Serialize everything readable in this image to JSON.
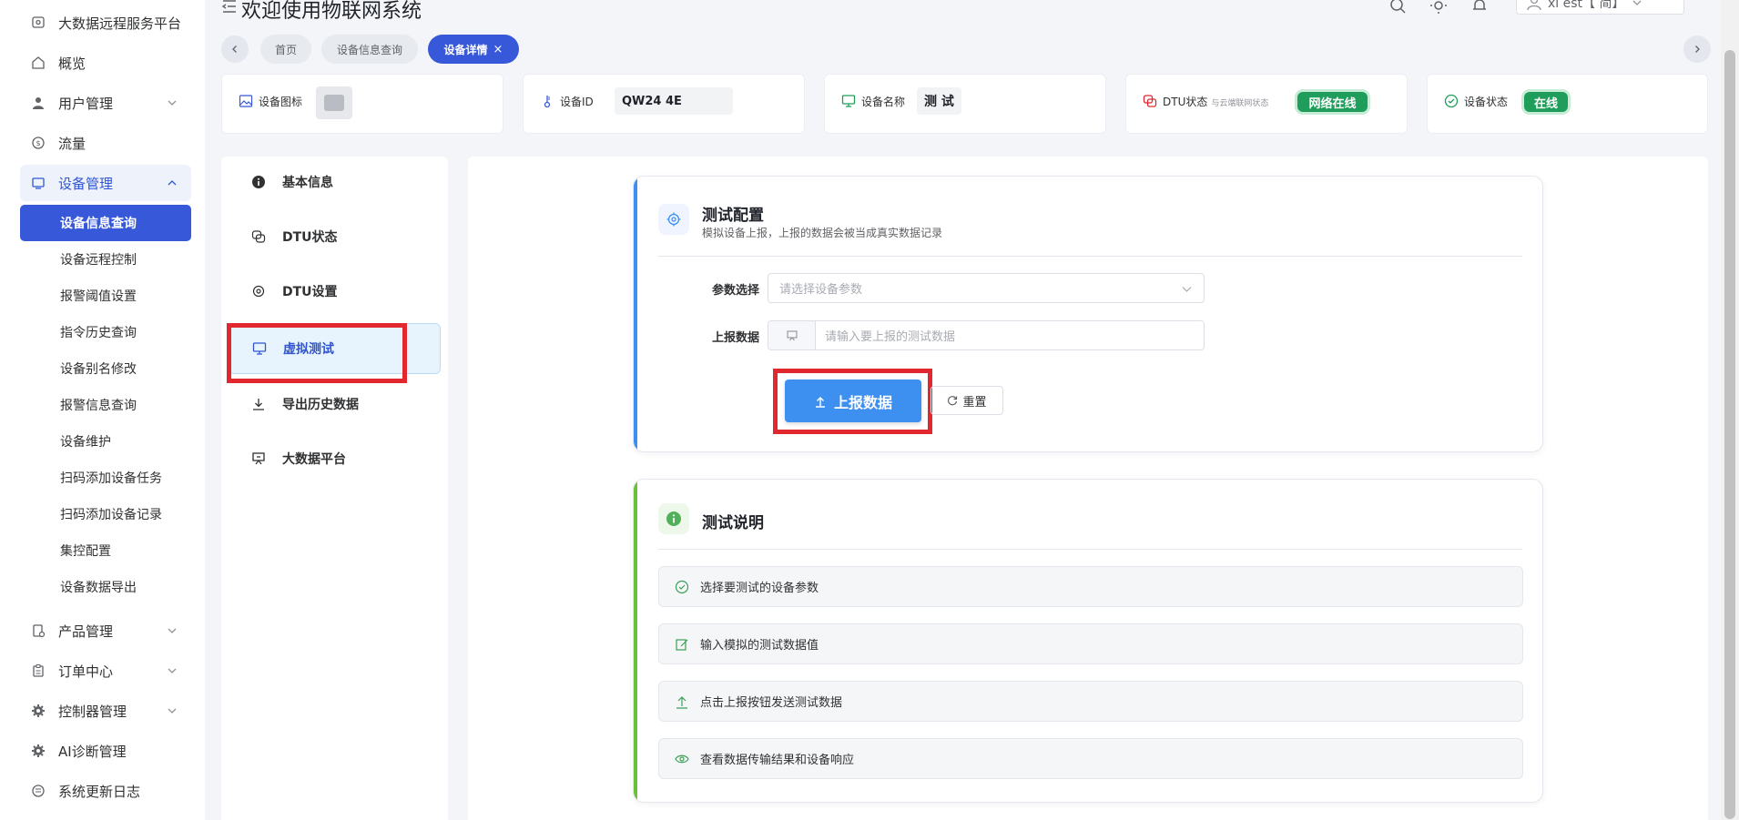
{
  "sidebar": {
    "platform": "大数据远程服务平台",
    "overview": "概览",
    "user_mgmt": "用户管理",
    "traffic": "流量",
    "device_mgmt": "设备管理",
    "sub_items": [
      "设备信息查询",
      "设备远程控制",
      "报警阈值设置",
      "指令历史查询",
      "设备别名修改",
      "报警信息查询",
      "设备维护",
      "扫码添加设备任务",
      "扫码添加设备记录",
      "集控配置",
      "设备数据导出"
    ],
    "product_mgmt": "产品管理",
    "order_center": "订单中心",
    "controller_mgmt": "控制器管理",
    "ai_diag": "AI诊断管理",
    "changelog": "系统更新日志"
  },
  "header": {
    "title": "欢迎使用物联网系统",
    "user_text": "xi       est【 简】"
  },
  "tabs": {
    "home": "首页",
    "device_query": "设备信息查询",
    "device_detail": "设备详情",
    "close_symbol": "×"
  },
  "info": {
    "icon_label": "设备图标",
    "id_label": "设备ID",
    "id_value": "QW24          4E",
    "name_label": "设备名称",
    "name_value": "测 试",
    "dtu_label": "DTU状态",
    "dtu_sub": "与云端联网状态",
    "dtu_value": "网络在线",
    "status_label": "设备状态",
    "status_value": "在线"
  },
  "detail_menu": {
    "basic": "基本信息",
    "dtu_status": "DTU状态",
    "dtu_settings": "DTU设置",
    "virtual_test": "虚拟测试",
    "export_history": "导出历史数据",
    "bigdata": "大数据平台"
  },
  "config": {
    "title": "测试配置",
    "desc": "模拟设备上报，上报的数据会被当成真实数据记录",
    "param_label": "参数选择",
    "param_placeholder": "请选择设备参数",
    "report_label": "上报数据",
    "report_placeholder": "请输入要上报的测试数据",
    "submit": "上报数据",
    "reset": "重置"
  },
  "guide": {
    "title": "测试说明",
    "steps": [
      "选择要测试的设备参数",
      "输入模拟的测试数据值",
      "点击上报按钮发送测试数据",
      "查看数据传输结果和设备响应"
    ]
  },
  "colors": {
    "primary": "#3658d9",
    "button": "#3d8ff0",
    "success": "#1f9d5a",
    "highlight": "#e0282e",
    "guide_accent": "#67c23a"
  }
}
